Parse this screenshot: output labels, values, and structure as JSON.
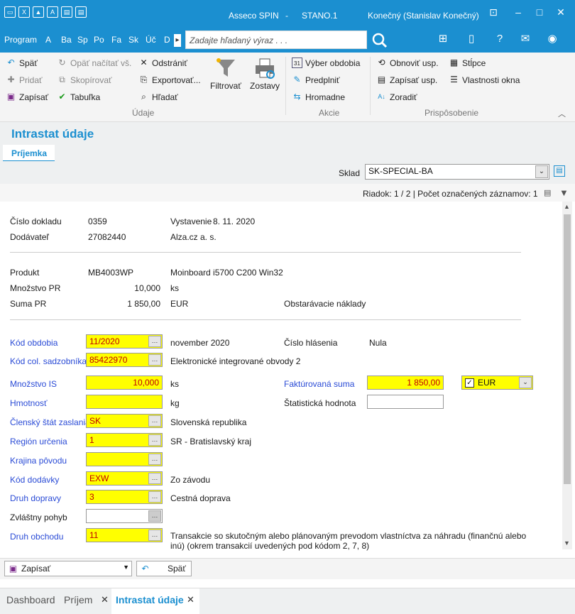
{
  "title": {
    "app": "Asseco SPIN",
    "sep": "-",
    "db": "STANO.1",
    "user": "Konečný (Stanislav Konečný)"
  },
  "menu": {
    "items": [
      "Program",
      "A",
      "Ba",
      "Sp",
      "Po",
      "Fa",
      "Sk",
      "Úč",
      "D"
    ],
    "search_placeholder": "Zadajte hľadaný výraz . . ."
  },
  "ribbon": {
    "spat": "Späť",
    "opat": "Opäť načítať vš.",
    "odstranit": "Odstrániť",
    "filtrovat": "Filtrovať",
    "zostavy": "Zostavy",
    "pridat": "Pridať",
    "skopirovat": "Skopírovať",
    "exportovat": "Exportovať...",
    "zapisat": "Zapísať",
    "tabulka": "Tabuľka",
    "hladat": "Hľadať",
    "vyber": "Výber obdobia",
    "predplnit": "Predplniť",
    "hromadne": "Hromadne",
    "obnovit": "Obnoviť usp.",
    "zapisat_usp": "Zapísať usp.",
    "zoradit": "Zoradiť",
    "stlpce": "Stĺpce",
    "vlastnosti": "Vlastnosti okna",
    "grp_udaje": "Údaje",
    "grp_akcie": "Akcie",
    "grp_prisposobenie": "Prispôsobenie"
  },
  "page": {
    "title": "Intrastat údaje",
    "tab": "Príjemka"
  },
  "sklad": {
    "label": "Sklad",
    "value": "SK-SPECIAL-BA"
  },
  "status": {
    "text": "Riadok: 1 / 2 | Počet označených záznamov: 1"
  },
  "doc": {
    "cislo_label": "Číslo dokladu",
    "cislo": "0359",
    "vyst_label": "Vystavenie",
    "vyst": "8. 11. 2020",
    "dod_label": "Dodávateľ",
    "dod": "27082440",
    "dod_name": "Alza.cz a. s.",
    "prod_label": "Produkt",
    "prod": "MB4003WP",
    "prod_name": "Moinboard i5700 C200 Win32",
    "mnoz_label": "Množstvo PR",
    "mnoz": "10,000",
    "mnoz_unit": "ks",
    "suma_label": "Suma PR",
    "suma": "1 850,00",
    "suma_cur": "EUR",
    "suma_note": "Obstarávacie náklady"
  },
  "form": {
    "kod_obd_label": "Kód obdobia",
    "kod_obd": "11/2020",
    "kod_obd_text": "november 2020",
    "cislo_hl_label": "Číslo hlásenia",
    "cislo_hl": "Nula",
    "kod_col_label": "Kód col. sadzobníka",
    "kod_col": "85422970",
    "kod_col_text": "Elektronické integrované obvody 2",
    "mnoz_is_label": "Množstvo IS",
    "mnoz_is": "10,000",
    "mnoz_is_unit": "ks",
    "fakt_label": "Faktúrovaná suma",
    "fakt": "1 850,00",
    "fakt_cur": "EUR",
    "hmot_label": "Hmotnosť",
    "hmot": "",
    "hmot_unit": "kg",
    "stat_label": "Štatistická hodnota",
    "stat": "",
    "clen_label": "Členský štát zaslania",
    "clen": "SK",
    "clen_text": "Slovenská republika",
    "region_label": "Región určenia",
    "region": "1",
    "region_text": "SR - Bratislavský kraj",
    "krajina_label": "Krajina pôvodu",
    "krajina": "",
    "kod_dod_label": "Kód dodávky",
    "kod_dod": "EXW",
    "kod_dod_text": "Zo závodu",
    "druh_dop_label": "Druh dopravy",
    "druh_dop": "3",
    "druh_dop_text": "Cestná doprava",
    "zvl_label": "Zvláštny pohyb",
    "zvl": "",
    "druh_obch_label": "Druh obchodu",
    "druh_obch": "11",
    "druh_obch_text1": "Transakcie so skutočným alebo plánovaným prevodom vlastníctva za náhradu (finančnú alebo",
    "druh_obch_text2": "inú) (okrem transakcií uvedených pod kódom 2, 7, 8)"
  },
  "bottom": {
    "zapisat": "Zapísať",
    "spat": "Späť"
  },
  "tabs": [
    "Dashboard",
    "Príjem",
    "Intrastat údaje"
  ],
  "colors": {
    "accent": "#1b8fd0",
    "field": "#ffff00"
  }
}
